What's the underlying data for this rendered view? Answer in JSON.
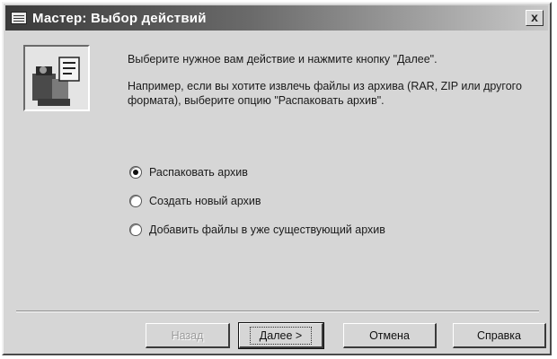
{
  "window": {
    "title": "Мастер: Выбор действий",
    "close_label": "x"
  },
  "intro": {
    "line1": "Выберите нужное вам действие и нажмите кнопку \"Далее\".",
    "line2": "Например, если вы хотите извлечь файлы из архива (RAR, ZIP или другого формата), выберите опцию \"Распаковать архив\"."
  },
  "options": [
    {
      "label": "Распаковать архив",
      "selected": true
    },
    {
      "label": "Создать новый архив",
      "selected": false
    },
    {
      "label": "Добавить файлы в уже существующий архив",
      "selected": false
    }
  ],
  "buttons": {
    "back": "Назад",
    "next": "Далее >",
    "cancel": "Отмена",
    "help": "Справка"
  },
  "icons": {
    "title": "archive-wizard-icon",
    "wizard_image": "wizard-illustration-icon",
    "close": "close-icon"
  },
  "colors": {
    "dialog_face": "#d6d6d6",
    "title_gradient_start": "#3a3a3a",
    "title_gradient_end": "#c8c8c8"
  }
}
